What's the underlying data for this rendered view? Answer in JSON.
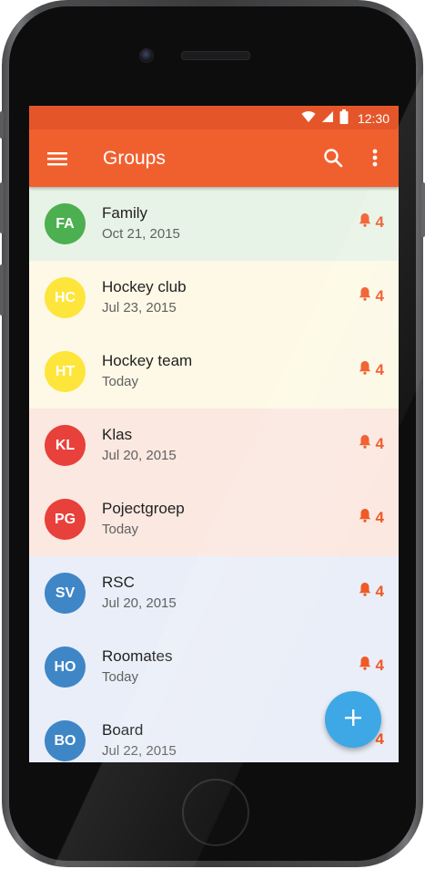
{
  "status_bar": {
    "time": "12:30"
  },
  "app_bar": {
    "title": "Groups"
  },
  "groups": [
    {
      "initials": "FA",
      "name": "Family",
      "date": "Oct 21, 2015",
      "count": "4",
      "avatar_color": "#4caf50",
      "row_color": "#e8f3e7"
    },
    {
      "initials": "HC",
      "name": "Hockey club",
      "date": "Jul 23, 2015",
      "count": "4",
      "avatar_color": "#fde53b",
      "row_color": "#fdf9e6"
    },
    {
      "initials": "HT",
      "name": "Hockey team",
      "date": "Today",
      "count": "4",
      "avatar_color": "#fde53b",
      "row_color": "#fdf9e6"
    },
    {
      "initials": "KL",
      "name": "Klas",
      "date": "Jul 20, 2015",
      "count": "4",
      "avatar_color": "#e8403a",
      "row_color": "#fbe8e1"
    },
    {
      "initials": "PG",
      "name": "Pojectgroep",
      "date": "Today",
      "count": "4",
      "avatar_color": "#e8403a",
      "row_color": "#fbe8e1"
    },
    {
      "initials": "SV",
      "name": "RSC",
      "date": "Jul 20, 2015",
      "count": "4",
      "avatar_color": "#3f86c7",
      "row_color": "#eaeef8"
    },
    {
      "initials": "HO",
      "name": "Roomates",
      "date": "Today",
      "count": "4",
      "avatar_color": "#3f86c7",
      "row_color": "#eaeef8"
    },
    {
      "initials": "BO",
      "name": "Board",
      "date": "Jul 22, 2015",
      "count": "4",
      "avatar_color": "#3f86c7",
      "row_color": "#eaeef8"
    }
  ],
  "icons": {
    "menu": "hamburger-icon",
    "search": "search-icon",
    "more": "more-vert-icon",
    "notification": "bell-icon",
    "add": "plus-icon"
  },
  "colors": {
    "status_bar": "#e4562a",
    "app_bar": "#f0602f",
    "accent": "#ef5a27",
    "fab": "#3ea7e6"
  }
}
